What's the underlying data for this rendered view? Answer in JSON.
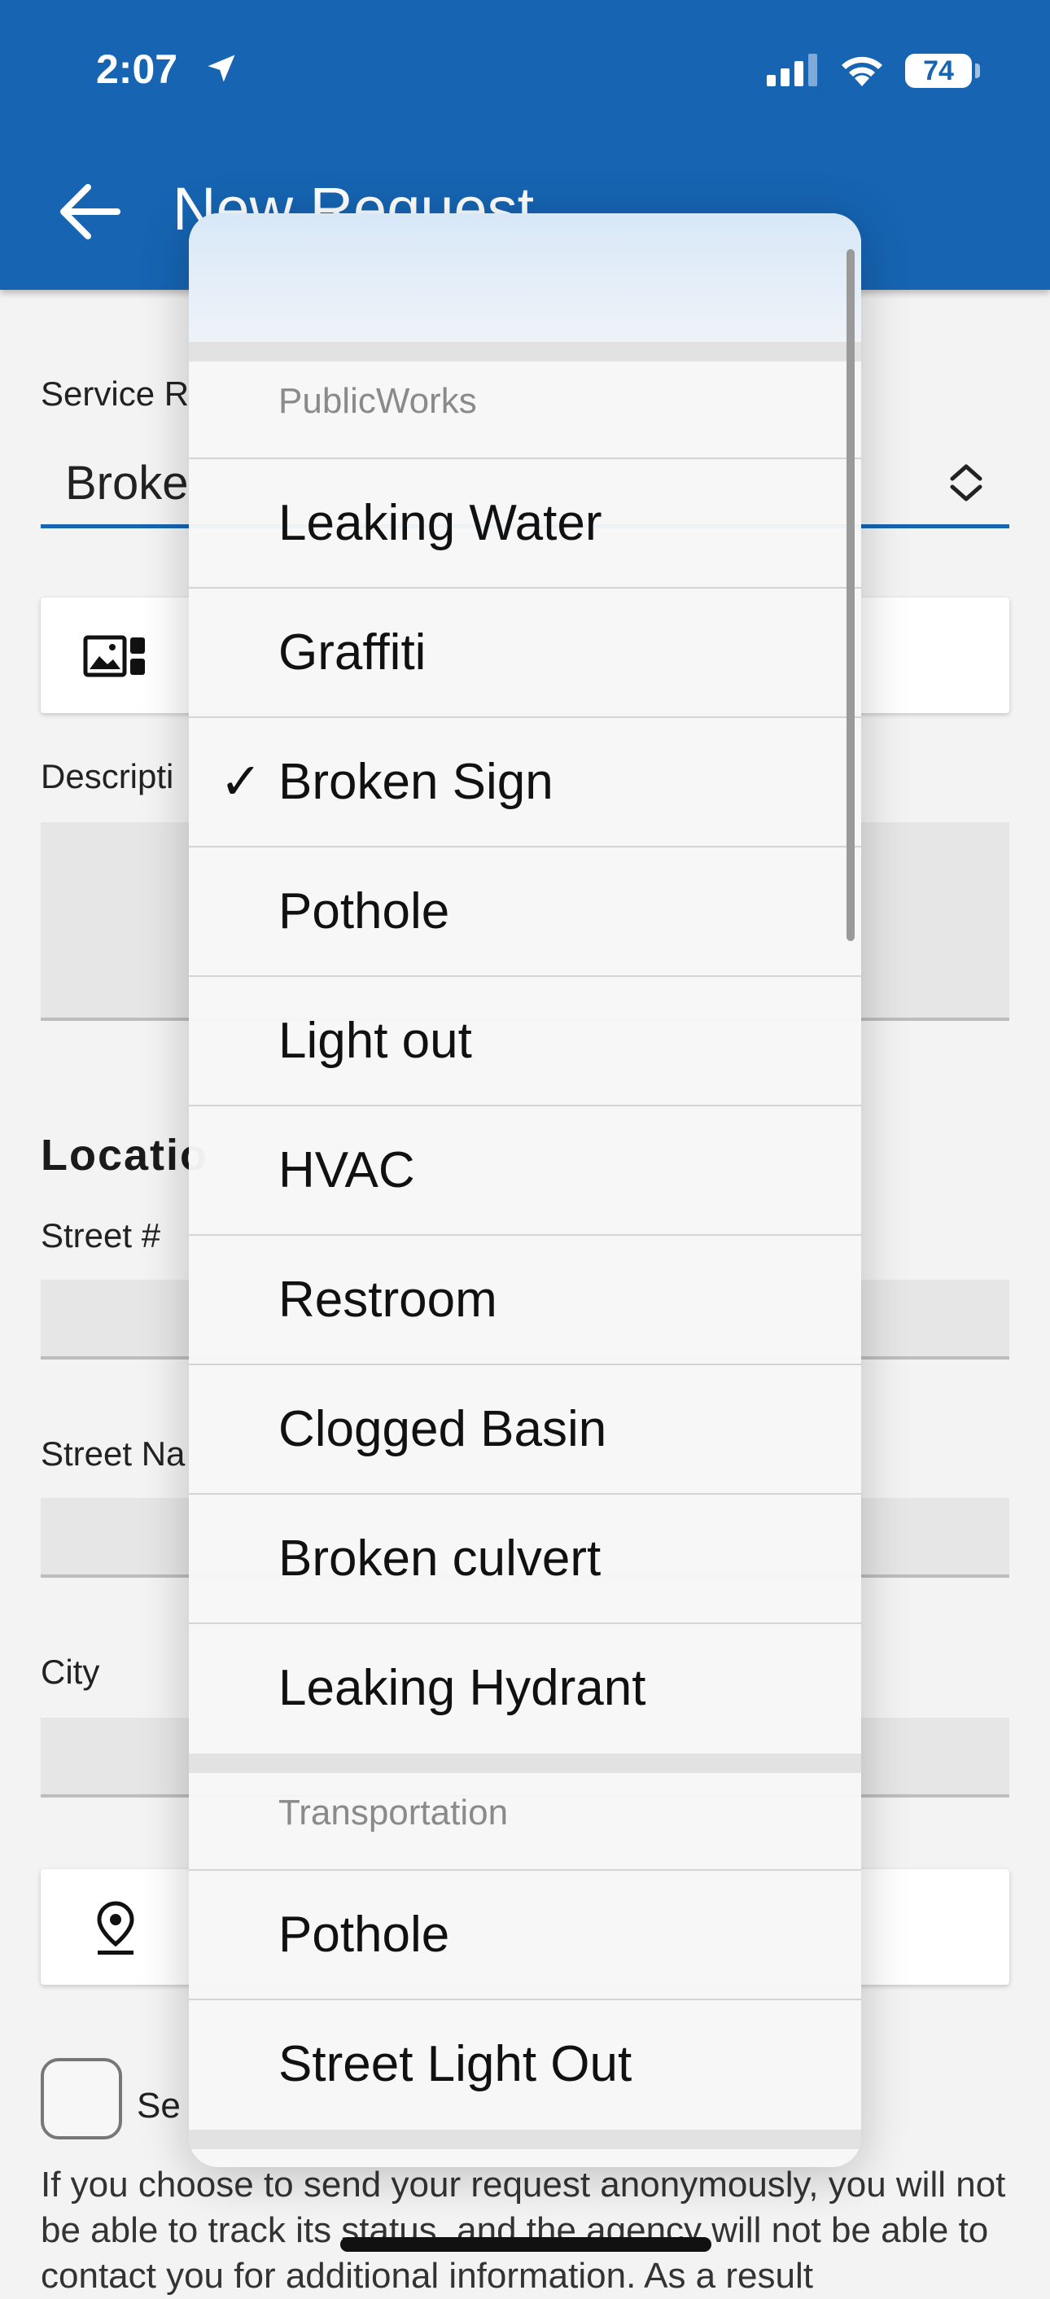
{
  "status_bar": {
    "time": "2:07",
    "battery": "74"
  },
  "appbar": {
    "title": "New Request"
  },
  "form": {
    "service_label": "Service R",
    "service_value": "Broke",
    "description_label": "Descripti",
    "location_heading": "Locatio",
    "street_number_label": "Street #",
    "street_name_label": "Street Na",
    "city_label": "City",
    "send_label": "Se",
    "disclaimer": "If you choose to send your request anonymously, you will not be able to track its status, and the agency will not be able to contact you for additional information. As a result"
  },
  "dropdown": {
    "groups": [
      {
        "header": "PublicWorks",
        "items": [
          "Leaking Water",
          "Graffiti",
          "Broken Sign",
          "Pothole",
          "Light out",
          "HVAC",
          "Restroom",
          "Clogged Basin",
          "Broken culvert",
          "Leaking Hydrant"
        ]
      },
      {
        "header": "Transportation",
        "items": [
          "Pothole",
          "Street Light Out"
        ]
      }
    ],
    "selected": "Broken Sign",
    "check_glyph": "✓"
  },
  "colors": {
    "primary": "#1664b2",
    "background": "#f3f3f3"
  }
}
